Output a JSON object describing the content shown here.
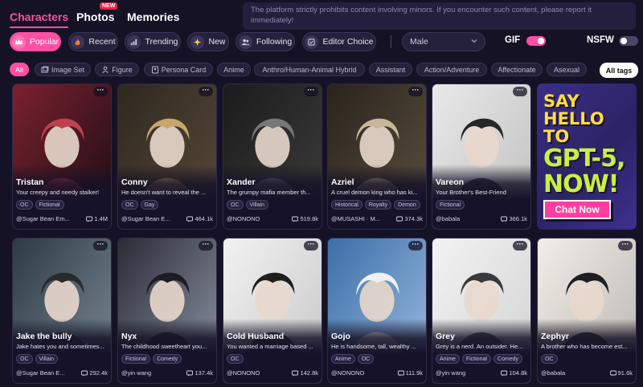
{
  "nav": {
    "tabs": [
      {
        "label": "Characters",
        "active": true
      },
      {
        "label": "Photos",
        "badge": "NEW"
      },
      {
        "label": "Memories"
      }
    ],
    "notice": "The platform strictly prohibits content involving minors. If you encounter such content, please report it immediately!"
  },
  "filters": {
    "buttons": [
      {
        "label": "Popular",
        "icon": "crown-icon",
        "active": true
      },
      {
        "label": "Recent",
        "icon": "flame-icon"
      },
      {
        "label": "Trending",
        "icon": "trending-icon"
      },
      {
        "label": "New",
        "icon": "sparkle-icon"
      },
      {
        "label": "Following",
        "icon": "users-icon"
      },
      {
        "label": "Editor Choice",
        "icon": "editor-icon"
      }
    ],
    "gender_select": "Male",
    "gif_label": "GIF",
    "gif_on": true,
    "nsfw_label": "NSFW",
    "nsfw_on": false
  },
  "tags": {
    "items": [
      {
        "label": "All",
        "active": true
      },
      {
        "label": "Image Set",
        "icon": "image-set-icon"
      },
      {
        "label": "Figure",
        "icon": "figure-icon"
      },
      {
        "label": "Persona Card",
        "icon": "persona-card-icon"
      },
      {
        "label": "Anime"
      },
      {
        "label": "Anthro/Human-Animal Hybrid"
      },
      {
        "label": "Assistant"
      },
      {
        "label": "Action/Adventure"
      },
      {
        "label": "Affectionate"
      },
      {
        "label": "Asexual"
      }
    ],
    "all_tags_label": "All tags"
  },
  "cards": [
    {
      "name": "Tristan",
      "desc": "Your creepy and needy stalker!",
      "tags": [
        "OC",
        "Fictional"
      ],
      "author": "@Sugar Bean Em...",
      "count": "1.4M"
    },
    {
      "name": "Conny",
      "desc": "He doesn't want to reveal the ...",
      "tags": [
        "OC",
        "Gay"
      ],
      "author": "@Sugar Bean E...",
      "count": "464.1k"
    },
    {
      "name": "Xander",
      "desc": "The grumpy mafia member th...",
      "tags": [
        "OC",
        "Villain"
      ],
      "author": "@NONONO",
      "count": "519.8k"
    },
    {
      "name": "Azriel",
      "desc": "A cruel demon king who has ki...",
      "tags": [
        "Historical",
        "Royalty",
        "Demon"
      ],
      "author": "@MUSASHI · M...",
      "count": "374.3k"
    },
    {
      "name": "Vareon",
      "desc": "Your Brother's Best-Friend",
      "tags": [
        "Fictional"
      ],
      "author": "@babala",
      "count": "366.1k"
    },
    {
      "name": "Jake the bully",
      "desc": "Jake hates you and sometimes...",
      "tags": [
        "OC",
        "Villain"
      ],
      "author": "@Sugar Bean E...",
      "count": "292.4k"
    },
    {
      "name": "Nyx",
      "desc": "The childhood sweetheart you...",
      "tags": [
        "Fictional",
        "Comedy"
      ],
      "author": "@yin wang",
      "count": "137.4k"
    },
    {
      "name": "Cold Husband",
      "desc": "You wanted a marriage based ...",
      "tags": [
        "OC"
      ],
      "author": "@NONONO",
      "count": "142.8k"
    },
    {
      "name": "Gojo",
      "desc": "He is handsome, tall, wealthy ...",
      "tags": [
        "Anime",
        "OC"
      ],
      "author": "@NONONO",
      "count": "111.9k"
    },
    {
      "name": "Grey",
      "desc": "Grey is a nerd. An outsider. He...",
      "tags": [
        "Anime",
        "Fictional",
        "Comedy"
      ],
      "author": "@yin wang",
      "count": "104.8k"
    },
    {
      "name": "Zephyr",
      "desc": "A brother who has become est...",
      "tags": [
        "OC"
      ],
      "author": "@babala",
      "count": "91.6k"
    }
  ],
  "ad": {
    "line1": "SAY",
    "line2": "HELLO",
    "line3": "TO",
    "line4": "GPT-5,",
    "line5": "NOW!",
    "button": "Chat Now"
  },
  "more_label": "···"
}
